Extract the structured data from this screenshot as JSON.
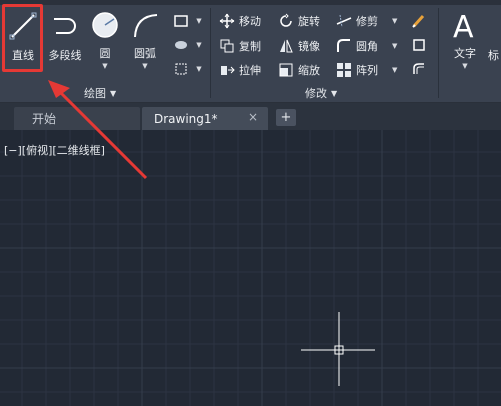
{
  "ribbon": {
    "draw_panel": {
      "label": "绘图",
      "tools": {
        "line": "直线",
        "polyline": "多段线",
        "circle": "圆",
        "arc": "圆弧"
      }
    },
    "modify_panel": {
      "label": "修改",
      "tools": {
        "move": "移动",
        "rotate": "旋转",
        "trim": "修剪",
        "copy": "复制",
        "mirror": "镜像",
        "fillet": "圆角",
        "stretch": "拉伸",
        "scale": "缩放",
        "array": "阵列"
      }
    },
    "annotation_panel": {
      "text": "文字",
      "partial_label": "标"
    }
  },
  "tabs": {
    "start": "开始",
    "drawing": "Drawing1*",
    "close": "×",
    "add": "+"
  },
  "viewport": {
    "label": "[−][俯视][二维线框]"
  },
  "colors": {
    "ribbon_bg": "#3a4250",
    "canvas_bg": "#222935",
    "highlight": "#e53935",
    "arrow": "#e53935"
  }
}
